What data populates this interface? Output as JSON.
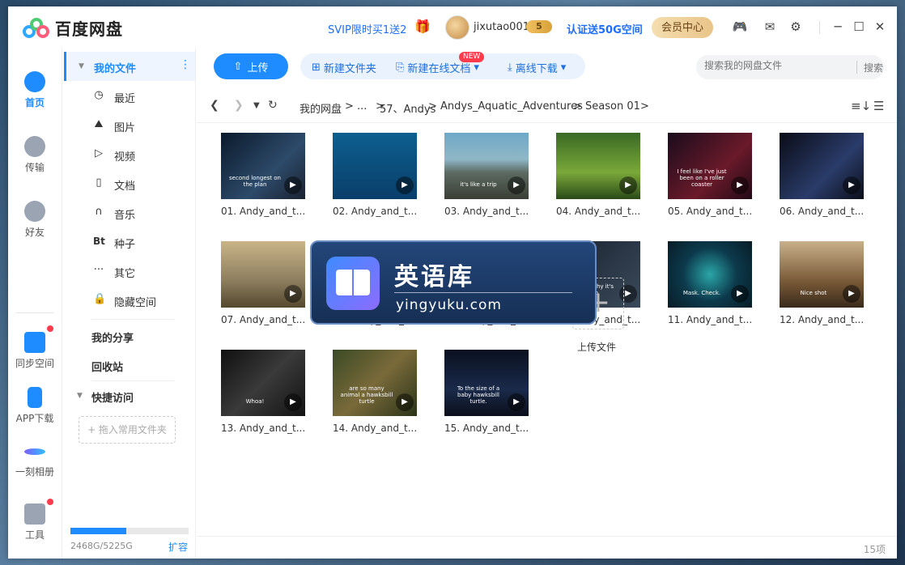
{
  "app": {
    "title": "百度网盘",
    "promo": "SVIP限时买1送2",
    "username": "jixutao001",
    "vip_level": "5",
    "verify_promo": "认证送50G空间",
    "member_center": "会员中心"
  },
  "rail": {
    "items": [
      {
        "label": "首页"
      },
      {
        "label": "传输"
      },
      {
        "label": "好友"
      },
      {
        "label": "同步空间"
      },
      {
        "label": "APP下载"
      },
      {
        "label": "一刻相册"
      },
      {
        "label": "工具"
      }
    ]
  },
  "sidebar": {
    "my_files": "我的文件",
    "categories": [
      {
        "label": "最近",
        "icon": "clock-icon"
      },
      {
        "label": "图片",
        "icon": "mountain-icon"
      },
      {
        "label": "视频",
        "icon": "play-icon"
      },
      {
        "label": "文档",
        "icon": "doc-icon"
      },
      {
        "label": "音乐",
        "icon": "headphones-icon"
      },
      {
        "label": "种子",
        "icon": "bt-icon"
      },
      {
        "label": "其它",
        "icon": "dots-icon"
      },
      {
        "label": "隐藏空间",
        "icon": "lock-icon"
      }
    ],
    "bt_text": "Bt",
    "my_share": "我的分享",
    "recycle": "回收站",
    "quick_access": "快捷访问",
    "drag_hint": "+ 拖入常用文件夹",
    "storage_text": "2468G/5225G",
    "storage_fraction": 0.47,
    "expand": "扩容"
  },
  "toolbar": {
    "upload": "上传",
    "new_folder": "新建文件夹",
    "new_online_doc": "新建在线文档",
    "new_badge": "NEW",
    "offline_download": "离线下载",
    "search_placeholder": "搜索我的网盘文件",
    "search_button": "搜索"
  },
  "breadcrumb": [
    "我的网盘",
    "...",
    "57、Andys",
    "Andys_Aquatic_Adventures",
    "Season 01"
  ],
  "breadcrumb_sep": ">",
  "files": [
    {
      "name": "01. Andy_and_t...",
      "caption": "second longest on the plan"
    },
    {
      "name": "02. Andy_and_t...",
      "caption": ""
    },
    {
      "name": "03. Andy_and_t...",
      "caption": "it's like a trip"
    },
    {
      "name": "04. Andy_and_t...",
      "caption": ""
    },
    {
      "name": "05. Andy_and_t...",
      "caption": "I feel like I've just been on a roller coaster"
    },
    {
      "name": "06. Andy_and_t...",
      "caption": ""
    },
    {
      "name": "07. Andy_and_t...",
      "caption": ""
    },
    {
      "name": "08. Andy_and_t...",
      "caption": ""
    },
    {
      "name": "09. Andy_and_t...",
      "caption": ""
    },
    {
      "name": "10. Andy_and_t...",
      "caption": "explains why it's propo"
    },
    {
      "name": "11. Andy_and_t...",
      "caption": "Mask. Check."
    },
    {
      "name": "12. Andy_and_t...",
      "caption": "Nice shot"
    },
    {
      "name": "13. Andy_and_t...",
      "caption": "Whoa!"
    },
    {
      "name": "14. Andy_and_t...",
      "caption": "are so many animal a hawksbill turtle"
    },
    {
      "name": "15. Andy_and_t...",
      "caption": "To the size of a baby hawksbill turtle."
    }
  ],
  "upload_tile_label": "上传文件",
  "item_count": "15项",
  "watermark": {
    "title": "英语库",
    "url": "yingyuku.com"
  },
  "colors": {
    "accent": "#1e8cff",
    "promo": "#1e6fff",
    "badge_red": "#ff3b4d"
  }
}
